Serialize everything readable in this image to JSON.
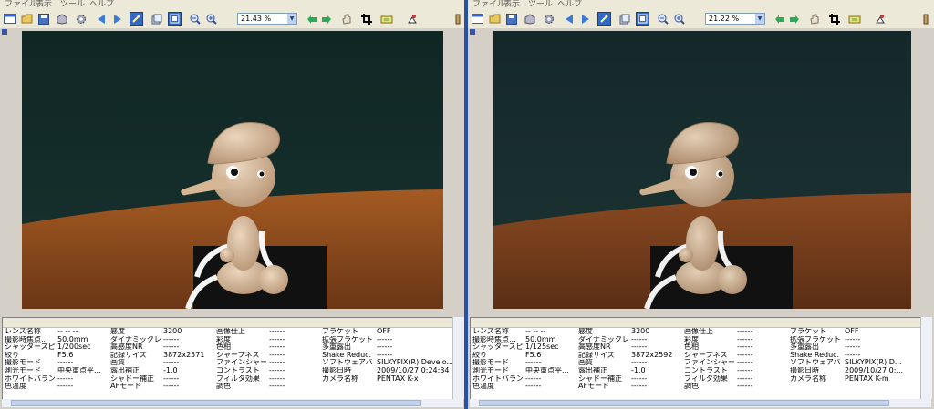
{
  "menu": [
    "ファイル",
    "表示",
    "ツール",
    "ヘルプ"
  ],
  "toolbar_icons": [
    "new-window-icon",
    "open-icon",
    "save-icon",
    "box-icon",
    "gear-icon",
    "prev-arrow-icon",
    "next-arrow-icon",
    "eyedropper-icon",
    "layers-icon",
    "fit-window-icon",
    "zoom-out-icon",
    "zoom-in-icon",
    "zoom-dropdown",
    "undo-icon",
    "redo-icon",
    "hand-icon",
    "crop-icon",
    "print-icon",
    "color-picker-icon",
    "settings-icon"
  ],
  "left": {
    "zoom": "21.43 %",
    "properties": [
      [
        "レンズ名称",
        "-- -- --",
        "感度",
        "3200",
        "画像仕上",
        "------",
        "ブラケット",
        "OFF"
      ],
      [
        "撮影時焦点...",
        "50.0mm",
        "ダイナミックレン...",
        "------",
        "彩度",
        "------",
        "拡張ブラケット",
        "------"
      ],
      [
        "シャッタースピ...",
        "1/200sec",
        "高感度NR",
        "------",
        "色相",
        "------",
        "多重露出",
        "------"
      ],
      [
        "絞り",
        "F5.6",
        "記録サイズ",
        "3872x2571",
        "シャープネス",
        "------",
        "Shake Reduc...",
        "------"
      ],
      [
        "撮影モード",
        "------",
        "画質",
        "------",
        "ファインシャー...",
        "------",
        "ソフトウェアバ...",
        "SILKYPIX(R) Develo..."
      ],
      [
        "測光モード",
        "中央重点平...",
        "露出補正",
        "-1.0",
        "コントラスト",
        "------",
        "撮影日時",
        "2009/10/27 0:24:34"
      ],
      [
        "ホワイトバランス",
        "------",
        "シャドー補正",
        "------",
        "フィルタ効果",
        "------",
        "カメラ名称",
        "PENTAX K-x"
      ],
      [
        "色温度",
        "------",
        "AFモード",
        "------",
        "調色",
        "------",
        "",
        ""
      ]
    ]
  },
  "right": {
    "zoom": "21.22 %",
    "properties": [
      [
        "レンズ名称",
        "-- -- --",
        "感度",
        "3200",
        "画像仕上",
        "------",
        "ブラケット",
        "OFF"
      ],
      [
        "撮影時焦点...",
        "50.0mm",
        "ダイナミックレン...",
        "------",
        "彩度",
        "------",
        "拡張ブラケット",
        "------"
      ],
      [
        "シャッタースピ...",
        "1/125sec",
        "高感度NR",
        "------",
        "色相",
        "------",
        "多重露出",
        "------"
      ],
      [
        "絞り",
        "F5.6",
        "記録サイズ",
        "3872x2592",
        "シャープネス",
        "------",
        "Shake Reduc...",
        "------"
      ],
      [
        "撮影モード",
        "------",
        "画質",
        "------",
        "ファインシャー...",
        "------",
        "ソフトウェアバ...",
        "SILKYPIX(R) D..."
      ],
      [
        "測光モード",
        "中央重点平...",
        "露出補正",
        "-1.0",
        "コントラスト",
        "------",
        "撮影日時",
        "2009/10/27 0:..."
      ],
      [
        "ホワイトバランス",
        "------",
        "シャドー補正",
        "------",
        "フィルタ効果",
        "------",
        "カメラ名称",
        "PENTAX K-m"
      ],
      [
        "色温度",
        "------",
        "AFモード",
        "------",
        "調色",
        "------",
        "",
        ""
      ]
    ]
  },
  "colors": {
    "accent": "#316ac5",
    "divider": "#2a4fa8",
    "photo_bg_left": "#16302c",
    "photo_bg_right": "#1a2f2e",
    "table_left": "#a45a22",
    "table_right": "#8a4a22"
  }
}
